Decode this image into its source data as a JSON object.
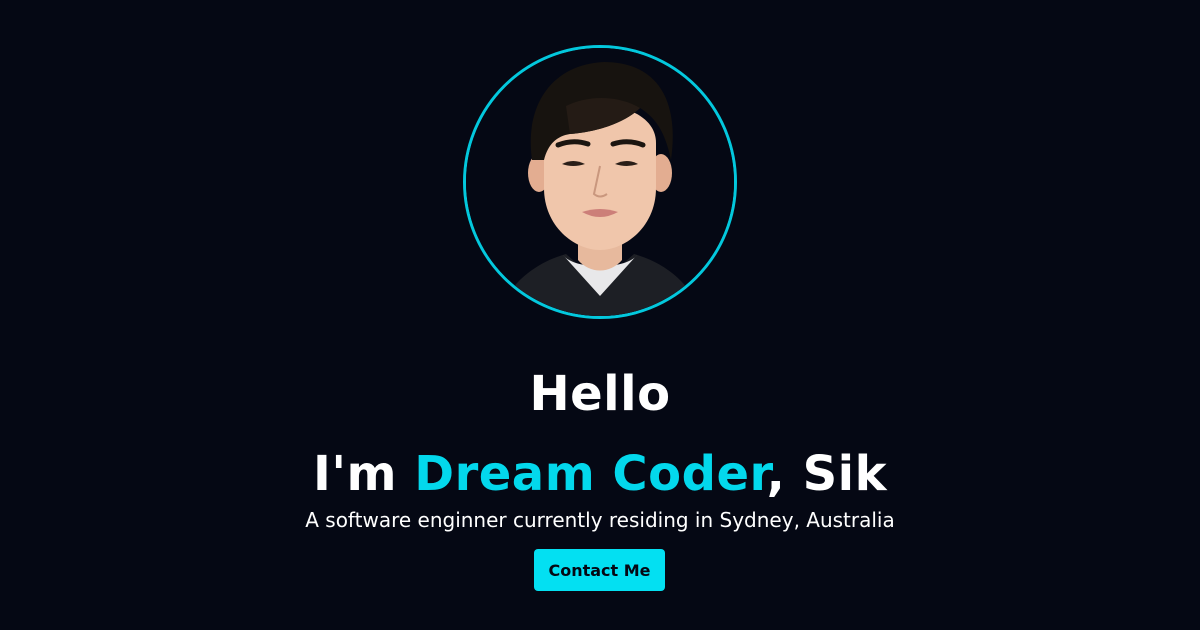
{
  "hero": {
    "avatar_alt": "profile photo",
    "greeting": "Hello",
    "intro_prefix": "I'm ",
    "intro_highlight": "Dream Coder",
    "intro_suffix": ", Sik",
    "tagline": "A software enginner currently residing in Sydney, Australia",
    "contact_label": "Contact Me"
  },
  "colors": {
    "background": "#050814",
    "accent": "#03d8ec",
    "button": "#03e0f2",
    "text": "#ffffff"
  }
}
